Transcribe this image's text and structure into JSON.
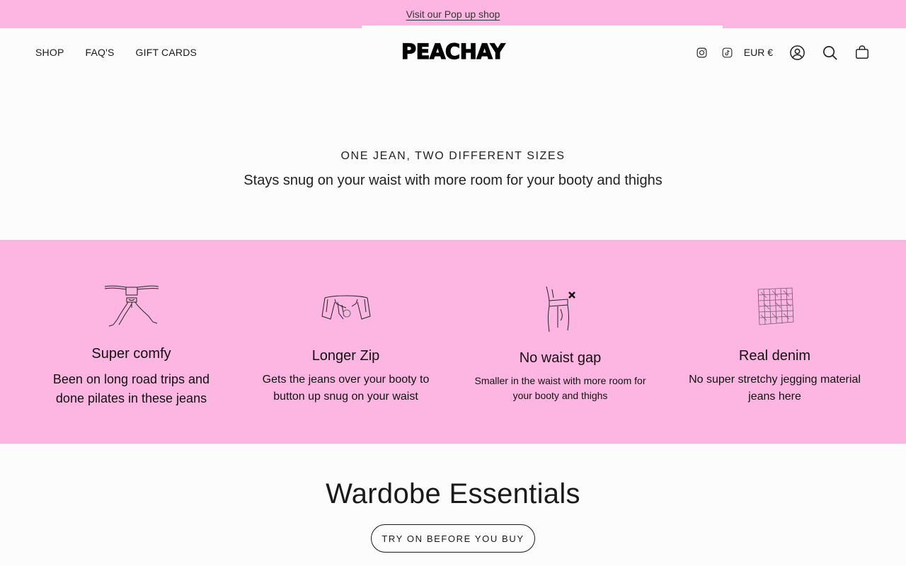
{
  "announcement": {
    "link_text": "Visit our Pop up shop"
  },
  "header": {
    "logo": "PEACHAY",
    "nav": [
      "SHOP",
      "FAQ'S",
      "GIFT CARDS"
    ],
    "currency": "EUR €",
    "icons": [
      "instagram-icon",
      "tiktok-icon",
      "account-icon",
      "search-icon",
      "cart-icon"
    ]
  },
  "intro": {
    "eyebrow": "ONE JEAN, TWO DIFFERENT SIZES",
    "subline": "Stays snug on your waist with more room for your booty and thighs"
  },
  "features": [
    {
      "title": "Super comfy",
      "text": "Been on long road trips and done pilates in these jeans",
      "icon": "yoga-pose-icon"
    },
    {
      "title": "Longer Zip",
      "text": "Gets the jeans over your booty to button up snug on your waist",
      "icon": "jeans-zip-icon"
    },
    {
      "title": "No waist gap",
      "text": "Smaller in the waist with more room for your booty and thighs",
      "icon": "waist-fit-icon"
    },
    {
      "title": "Real denim",
      "text": "No super stretchy jegging material jeans here",
      "icon": "denim-weave-icon"
    }
  ],
  "essentials": {
    "title": "Wardobe Essentials",
    "button": "TRY ON BEFORE YOU BUY"
  },
  "colors": {
    "accent_pink": "#fdb6e2",
    "text": "#1a1a1a",
    "background": "#fdfcfc"
  }
}
